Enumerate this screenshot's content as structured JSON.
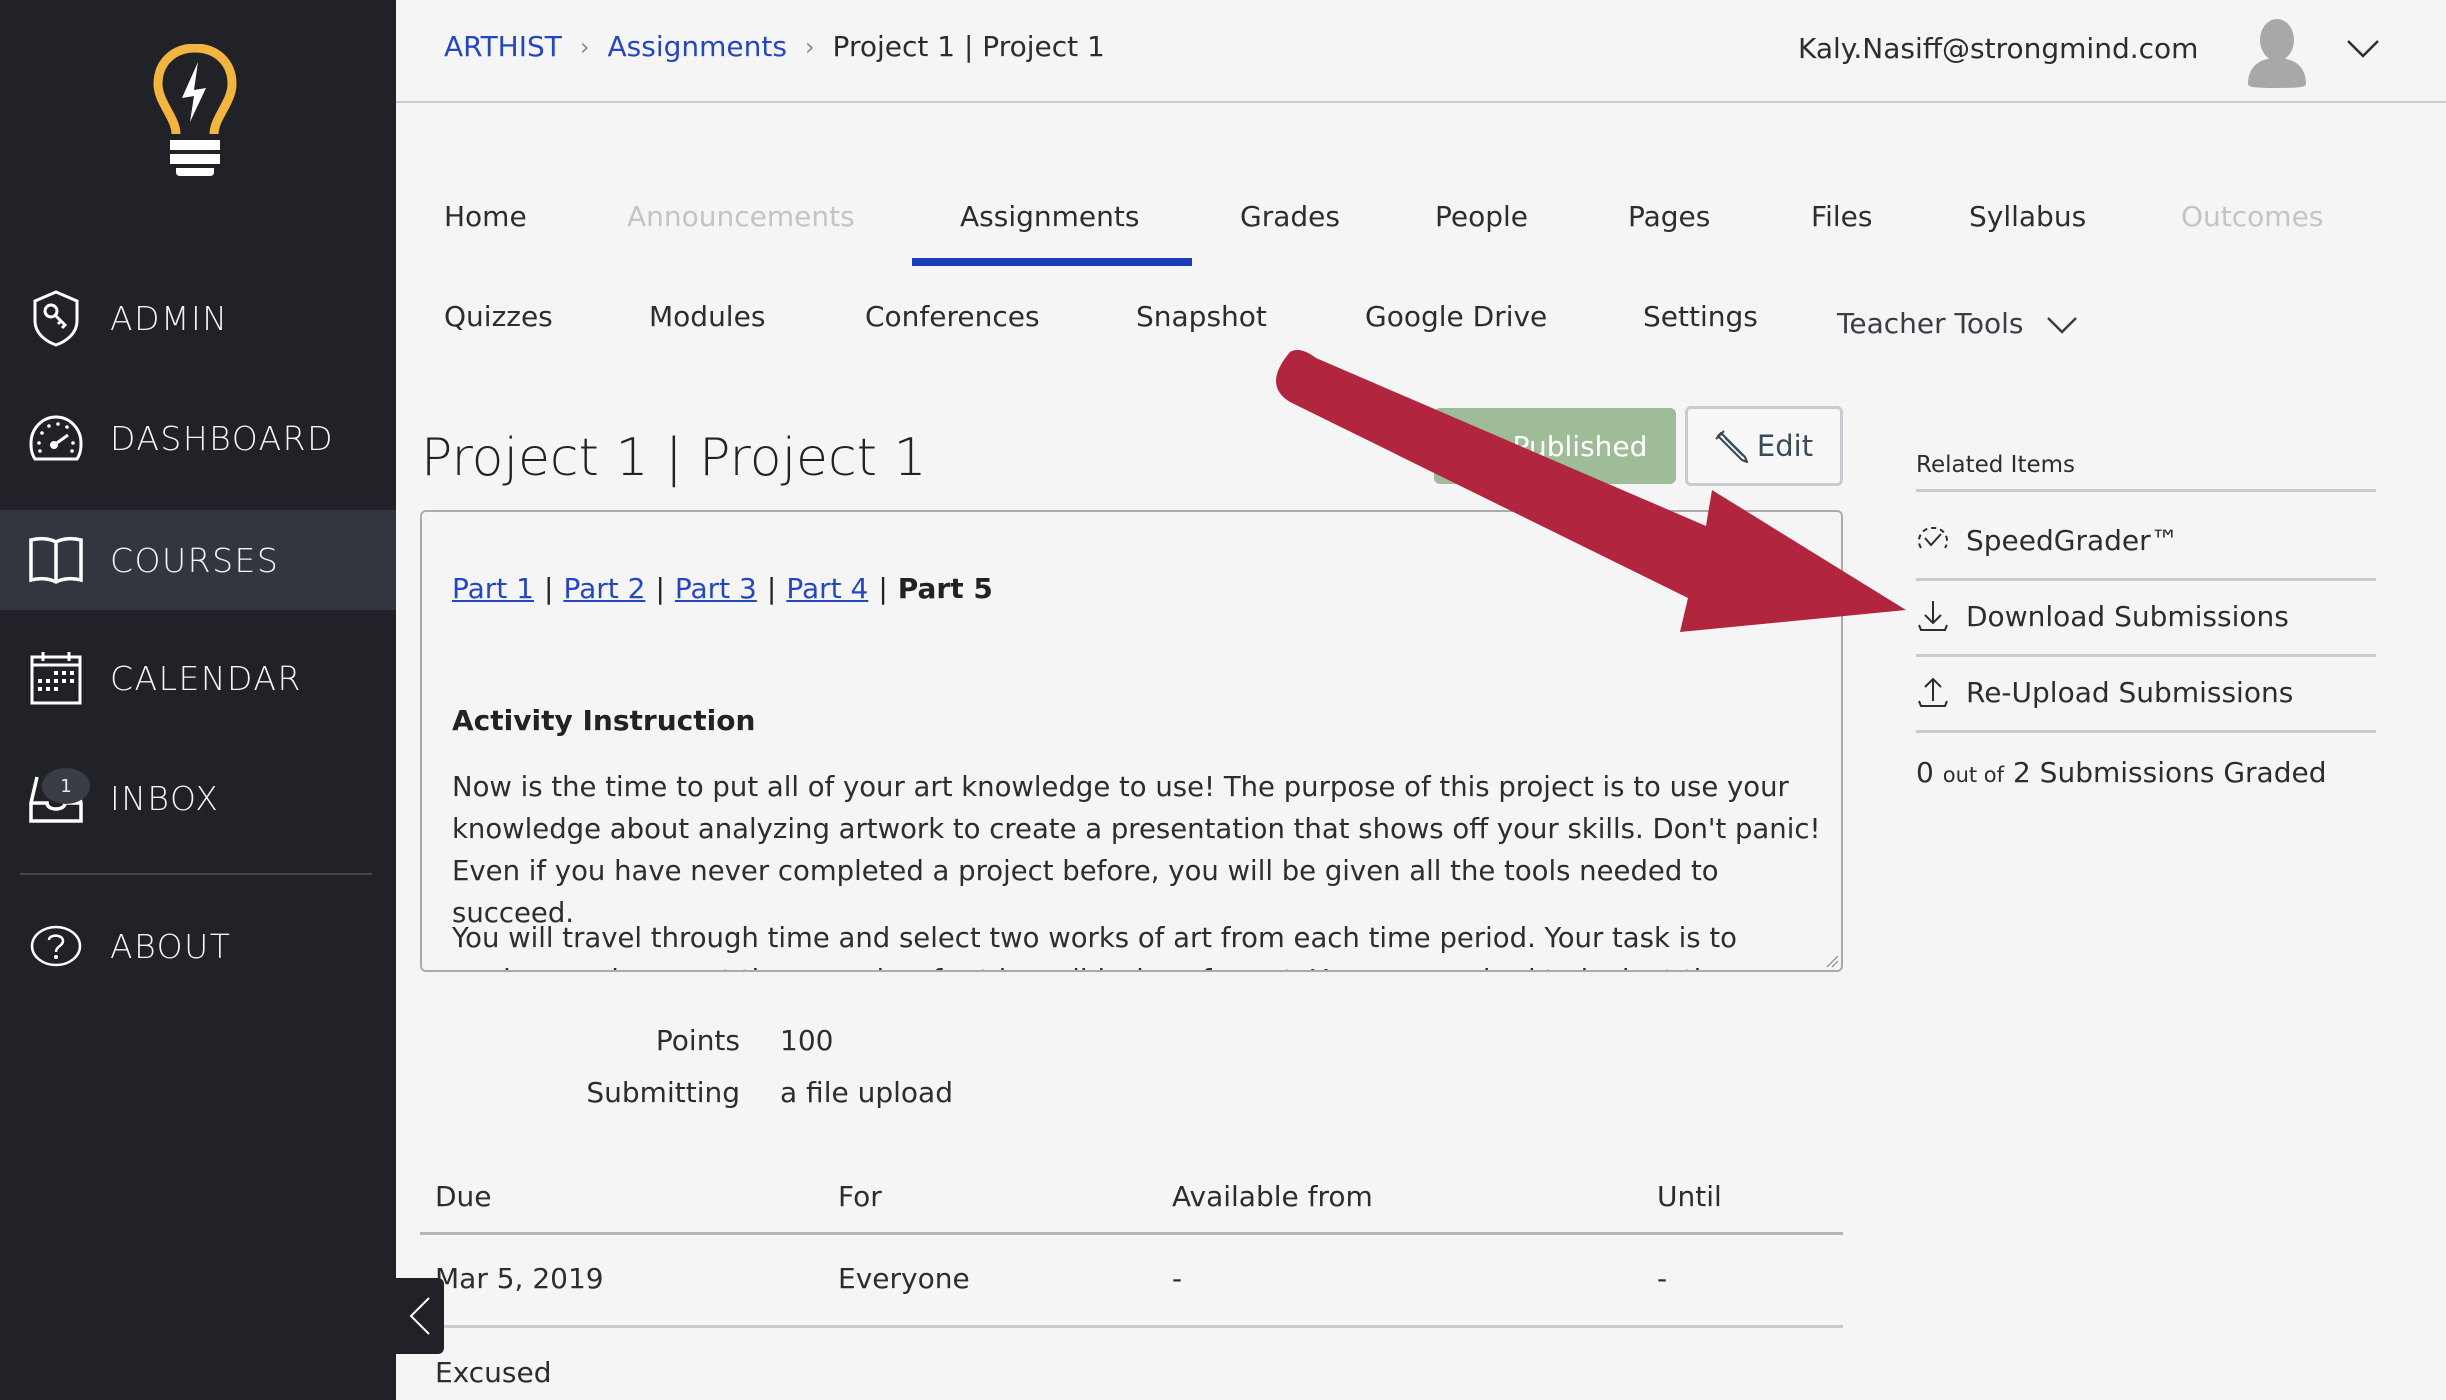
{
  "sidebar": {
    "logo": "lightbulb-logo",
    "items": [
      {
        "label": "ADMIN",
        "icon": "shield-key-icon"
      },
      {
        "label": "DASHBOARD",
        "icon": "speedometer-icon"
      },
      {
        "label": "COURSES",
        "icon": "book-icon",
        "active": true
      },
      {
        "label": "CALENDAR",
        "icon": "calendar-icon"
      },
      {
        "label": "INBOX",
        "icon": "inbox-icon",
        "badge": "1"
      },
      {
        "label": "ABOUT",
        "icon": "question-circle-icon"
      }
    ]
  },
  "header": {
    "breadcrumb": [
      {
        "label": "ARTHIST",
        "link": true
      },
      {
        "label": "Assignments",
        "link": true
      },
      {
        "label": "Project 1 | Project 1",
        "link": false
      }
    ],
    "user_email": "Kaly.Nasiff@strongmind.com"
  },
  "tabs": {
    "row1": [
      {
        "label": "Home",
        "disabled": false
      },
      {
        "label": "Announcements",
        "disabled": true
      },
      {
        "label": "Assignments",
        "active": true
      },
      {
        "label": "Grades"
      },
      {
        "label": "People"
      },
      {
        "label": "Pages"
      },
      {
        "label": "Files"
      },
      {
        "label": "Syllabus"
      },
      {
        "label": "Outcomes",
        "disabled": true
      }
    ],
    "row2": [
      {
        "label": "Quizzes"
      },
      {
        "label": "Modules"
      },
      {
        "label": "Conferences"
      },
      {
        "label": "Snapshot"
      },
      {
        "label": "Google Drive"
      },
      {
        "label": "Settings"
      },
      {
        "label": "Teacher Tools",
        "dropdown": true
      }
    ]
  },
  "assignment": {
    "title": "Project 1 | Project 1",
    "published_label": "Published",
    "edit_label": "Edit",
    "parts": [
      {
        "label": "Part 1",
        "link": true
      },
      {
        "label": "Part 2",
        "link": true
      },
      {
        "label": "Part 3",
        "link": true
      },
      {
        "label": "Part 4",
        "link": true
      },
      {
        "label": "Part 5",
        "link": false
      }
    ],
    "part_separator": "|",
    "activity_heading": "Activity Instruction",
    "paragraph1": "Now is the time to put all of your art knowledge to use! The purpose of this project is to use your knowledge about analyzing artwork to create a presentation that shows off your skills. Don't panic! Even if you have never completed a project before, you will be given all the tools needed to succeed.",
    "paragraph2": "You will travel through time and select two works of art from each time period. Your task is to analyze and present these works of art in a slideshow format. You are required to look at the artworks and use",
    "points_label": "Points",
    "points_value": "100",
    "submitting_label": "Submitting",
    "submitting_value": "a file upload"
  },
  "dates_table": {
    "headers": [
      "Due",
      "For",
      "Available from",
      "Until"
    ],
    "rows": [
      [
        "Mar 5, 2019",
        "Everyone",
        "-",
        "-"
      ]
    ],
    "footer": "Excused"
  },
  "related": {
    "title": "Related Items",
    "items": [
      {
        "label": "SpeedGrader™",
        "icon": "speedgrader-check-icon"
      },
      {
        "label": "Download Submissions",
        "icon": "download-icon"
      },
      {
        "label": "Re-Upload Submissions",
        "icon": "upload-icon"
      }
    ],
    "graded_count": "0",
    "graded_out_of": "out of",
    "graded_total": "2 Submissions Graded"
  },
  "colors": {
    "sidebar_bg": "#212227",
    "sidebar_active": "#33363e",
    "link_blue": "#2547be",
    "tab_underline": "#1a3eb8",
    "published_green": "#9fbc99",
    "logo_gold": "#f2b53f",
    "annotation_arrow": "#b1253f"
  }
}
